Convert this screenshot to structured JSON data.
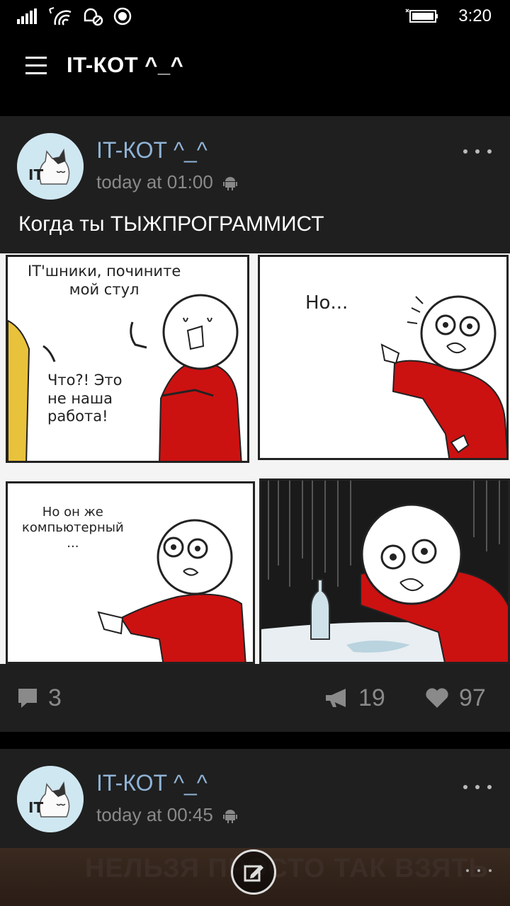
{
  "status_bar": {
    "time": "3:20",
    "icons": [
      "signal-icon",
      "wifi-icon",
      "quiet-hours-icon",
      "location-icon",
      "battery-icon"
    ]
  },
  "header": {
    "title": "IT-КОТ ^_^"
  },
  "posts": [
    {
      "author": "IT-КОТ ^_^",
      "time": "today at 01:00",
      "text": "Когда ты ТЫЖПРОГРАММИСТ",
      "comic": {
        "panel1_caption_top": "IT'шники, почините\nмой стул",
        "panel1_caption_bottom": "Что?! Это\nне наша\nработа!",
        "panel2_caption": "Но...",
        "panel3_caption": "Но он же\nкомпьютерный\n...",
        "panel4_caption": ""
      },
      "comments_count": "3",
      "reposts_count": "19",
      "likes_count": "97"
    },
    {
      "author": "IT-КОТ ^_^",
      "time": "today at 00:45",
      "preview_text": "НЕЛЬЗЯ ПРОСТО ТАК ВЗЯТЬ"
    }
  ],
  "colors": {
    "background": "#000000",
    "card": "#1f1f1f",
    "author": "#8fb3d6",
    "meta": "#8a8a8a",
    "comic_red": "#cc1111"
  }
}
